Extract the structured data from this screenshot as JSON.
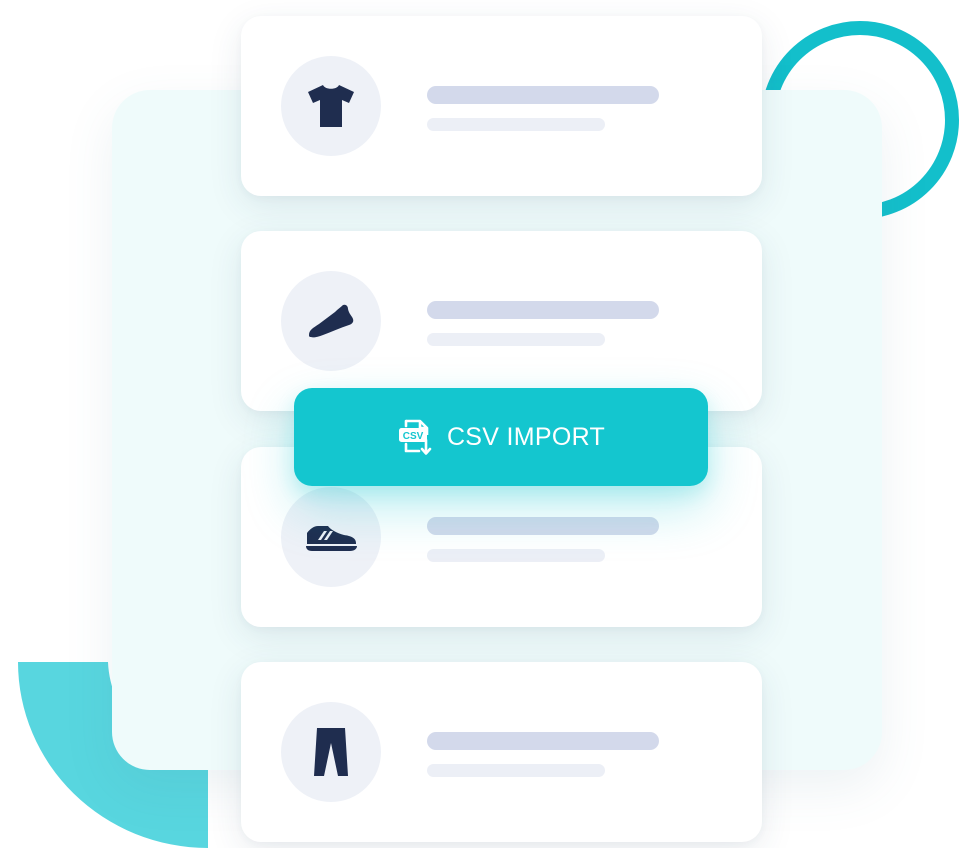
{
  "colors": {
    "accent": "#14c6cf",
    "ring": "#13bfcb",
    "quarter": "#58d6df",
    "panel": "#effbfb",
    "card": "#ffffff",
    "icon_circle": "#eef1f7",
    "icon_fill": "#1f2d4f",
    "placeholder_title": "#d3d9eb",
    "placeholder_sub": "#eceff6"
  },
  "products": [
    {
      "icon": "tshirt-icon"
    },
    {
      "icon": "shoe-icon"
    },
    {
      "icon": "sneaker-icon"
    },
    {
      "icon": "pants-icon"
    }
  ],
  "import_button": {
    "label": "CSV IMPORT",
    "icon": "csv-file-icon",
    "icon_text": "CSV"
  }
}
